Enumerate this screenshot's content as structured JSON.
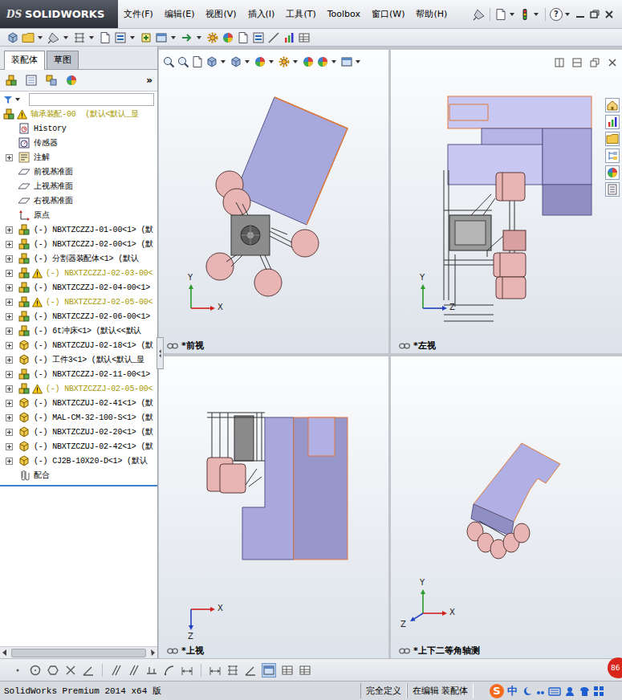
{
  "app": {
    "logo_mark": "DS",
    "logo_text": "SOLIDWORKS"
  },
  "menu": [
    {
      "label": "文件(F)"
    },
    {
      "label": "编辑(E)"
    },
    {
      "label": "视图(V)"
    },
    {
      "label": "插入(I)"
    },
    {
      "label": "工具(T)"
    },
    {
      "label": "Toolbox"
    },
    {
      "label": "窗口(W)"
    },
    {
      "label": "帮助(H)"
    }
  ],
  "help_glyph": "?",
  "panel": {
    "tabs": [
      {
        "label": "装配体",
        "selected": true
      },
      {
        "label": "草图",
        "selected": false
      }
    ],
    "more": "»"
  },
  "tree": {
    "root": {
      "label": "轴承装配-00  (默认<默认_显",
      "warning": true
    },
    "items": [
      {
        "label": "History",
        "kind": "history",
        "expandable": false,
        "warning": false
      },
      {
        "label": "传感器",
        "kind": "sensor",
        "expandable": false,
        "warning": false
      },
      {
        "label": "注解",
        "kind": "annotation",
        "expandable": true,
        "expanded": false,
        "warning": false
      },
      {
        "label": "前视基准面",
        "kind": "plane",
        "expandable": false,
        "warning": false
      },
      {
        "label": "上视基准面",
        "kind": "plane",
        "expandable": false,
        "warning": false
      },
      {
        "label": "右视基准面",
        "kind": "plane",
        "expandable": false,
        "warning": false
      },
      {
        "label": "原点",
        "kind": "origin",
        "expandable": false,
        "warning": false
      },
      {
        "label": "(-) NBXTZCZZJ-01-00<1> (默",
        "kind": "assembly",
        "expandable": true,
        "expanded": false,
        "warning": false
      },
      {
        "label": "(-) NBXTZCZZJ-02-00<1> (默",
        "kind": "assembly",
        "expandable": true,
        "expanded": false,
        "warning": false
      },
      {
        "label": "(-) 分割器装配体<1> (默认",
        "kind": "assembly",
        "expandable": true,
        "expanded": false,
        "warning": false
      },
      {
        "label": "(-) NBXTZCZZJ-02-03-00<",
        "kind": "assembly",
        "expandable": true,
        "expanded": false,
        "warning": true
      },
      {
        "label": "(-) NBXTZCZZJ-02-04-00<1>",
        "kind": "assembly",
        "expandable": true,
        "expanded": false,
        "warning": false
      },
      {
        "label": "(-) NBXTZCZZJ-02-05-00<",
        "kind": "assembly",
        "expandable": true,
        "expanded": false,
        "warning": true
      },
      {
        "label": "(-) NBXTZCZZJ-02-06-00<1>",
        "kind": "assembly",
        "expandable": true,
        "expanded": false,
        "warning": false
      },
      {
        "label": "(-) 6t冲床<1> (默认<<默认",
        "kind": "assembly",
        "expandable": true,
        "expanded": false,
        "warning": false
      },
      {
        "label": "(-) NBXTZCZUJ-02-18<1> (默",
        "kind": "part",
        "expandable": true,
        "expanded": false,
        "warning": false
      },
      {
        "label": "(-) 工件3<1> (默认<默认_显",
        "kind": "part",
        "expandable": true,
        "expanded": false,
        "warning": false
      },
      {
        "label": "(-) NBXTZCZZJ-02-11-00<1>",
        "kind": "assembly",
        "expandable": true,
        "expanded": false,
        "warning": false
      },
      {
        "label": "(-) NBXTZCZZJ-02-05-00<",
        "kind": "assembly",
        "expandable": true,
        "expanded": false,
        "warning": true
      },
      {
        "label": "(-) NBXTZCZUJ-02-41<1> (默",
        "kind": "part",
        "expandable": true,
        "expanded": false,
        "warning": false
      },
      {
        "label": "(-) MAL-CM-32-100-S<1> (默",
        "kind": "part",
        "expandable": true,
        "expanded": false,
        "warning": false
      },
      {
        "label": "(-) NBXTZCZUJ-02-20<1> (默",
        "kind": "part",
        "expandable": true,
        "expanded": false,
        "warning": false
      },
      {
        "label": "(-) NBXTZCZUJ-02-42<1> (默",
        "kind": "part",
        "expandable": true,
        "expanded": false,
        "warning": false
      },
      {
        "label": "(-) CJ2B-10X20-D<1> (默认",
        "kind": "part",
        "expandable": true,
        "expanded": false,
        "warning": false
      },
      {
        "label": "配合",
        "kind": "mates",
        "expandable": false,
        "warning": false
      }
    ]
  },
  "viewports": [
    {
      "label": "*前视",
      "kind": "front",
      "axes": [
        {
          "label": "Y",
          "dir": "up",
          "color": "#2a9a2a"
        },
        {
          "label": "X",
          "dir": "right",
          "color": "#d02020"
        }
      ]
    },
    {
      "label": "*左视",
      "kind": "left",
      "axes": [
        {
          "label": "Y",
          "dir": "up",
          "color": "#2a9a2a"
        },
        {
          "label": "Z",
          "dir": "right",
          "color": "#2040c0"
        }
      ]
    },
    {
      "label": "*上视",
      "kind": "top",
      "axes": [
        {
          "label": "X",
          "dir": "right",
          "color": "#d02020"
        },
        {
          "label": "Z",
          "dir": "down",
          "color": "#2040c0"
        }
      ]
    },
    {
      "label": "*上下二等角轴测",
      "kind": "iso",
      "axes": [
        {
          "label": "Y",
          "dir": "up",
          "color": "#2a9a2a"
        },
        {
          "label": "X",
          "dir": "right",
          "color": "#d02020"
        },
        {
          "label": "Z",
          "dir": "down-left",
          "color": "#2040c0"
        }
      ]
    }
  ],
  "status_bar": {
    "product": "SolidWorks Premium 2014 x64 版",
    "cells": [
      "完全定义",
      "在编辑 装配体"
    ]
  },
  "ime": {
    "logo": "S",
    "mode": "中"
  },
  "badge": "86"
}
